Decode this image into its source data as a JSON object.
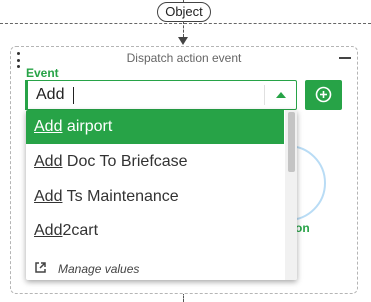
{
  "connector": {
    "label": "Object"
  },
  "card": {
    "title": "Dispatch action event",
    "field_label": "Event"
  },
  "combo": {
    "value": "Add",
    "placeholder": ""
  },
  "dropdown": {
    "options": [
      {
        "match": "Add",
        "rest": " airport",
        "selected": true
      },
      {
        "match": "Add",
        "rest": " Doc To Briefcase",
        "selected": false
      },
      {
        "match": "Add",
        "rest": " Ts Maintenance",
        "selected": false
      },
      {
        "match": "Add",
        "rest": "2cart",
        "selected": false
      }
    ],
    "manage_label": "Manage values"
  },
  "background": {
    "partial_text": "on"
  },
  "colors": {
    "accent": "#27a347",
    "circle": "#b9dcf5"
  }
}
